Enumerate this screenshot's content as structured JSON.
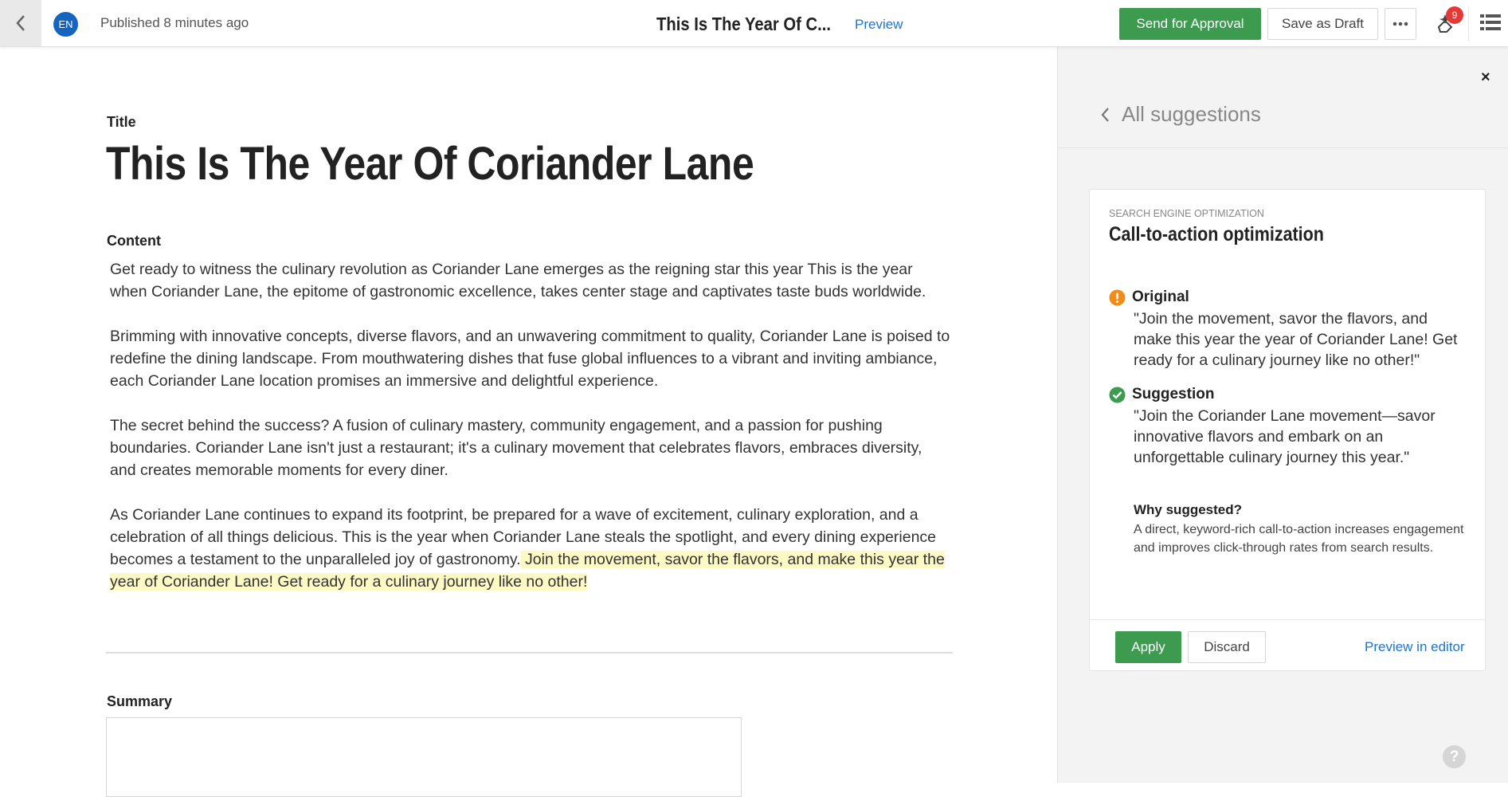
{
  "header": {
    "language": "EN",
    "status": "Published 8 minutes ago",
    "doc_title": "This Is The Year Of C...",
    "preview_label": "Preview",
    "send_label": "Send for Approval",
    "draft_label": "Save as Draft",
    "notification_count": "9"
  },
  "editor": {
    "title_label": "Title",
    "title": "This Is The Year Of Coriander Lane",
    "content_label": "Content",
    "paragraphs": [
      "Get ready to witness the culinary revolution as Coriander Lane emerges as the reigning star this year This is the year when Coriander Lane, the epitome of gastronomic excellence, takes center stage and captivates taste buds worldwide.",
      "Brimming with innovative concepts, diverse flavors, and an unwavering commitment to quality, Coriander Lane is poised to redefine the dining landscape. From mouthwatering dishes that fuse global influences to a vibrant and inviting ambiance, each Coriander Lane location promises an immersive and delightful experience.",
      "The secret behind the success? A fusion of culinary mastery, community engagement, and a passion for pushing boundaries. Coriander Lane isn't just a restaurant; it's a culinary movement that celebrates flavors, embraces diversity, and creates memorable moments for every diner.",
      "As Coriander Lane continues to expand its footprint, be prepared for a wave of excitement, culinary exploration, and a celebration of all things delicious. This is the year when Coriander Lane steals the spotlight, and every dining experience becomes a testament to the unparalleled joy of gastronomy."
    ],
    "highlighted": " Join the movement, savor the flavors, and make this year the year of Coriander Lane! Get ready for a culinary journey like no other! ",
    "summary_label": "Summary"
  },
  "panel": {
    "back_label": "All suggestions",
    "close": "×",
    "card": {
      "category": "SEARCH ENGINE OPTIMIZATION",
      "title": "Call-to-action optimization",
      "original_label": "Original",
      "original_text": "\"Join the movement, savor the flavors, and make this year the year of Coriander Lane! Get ready for a culinary journey like no other!\"",
      "suggestion_label": "Suggestion",
      "suggestion_text": "\"Join the Coriander Lane movement—savor innovative flavors and embark on an unforgettable culinary journey this year.\"",
      "why_label": "Why suggested?",
      "why_text": "A direct, keyword-rich call-to-action increases engagement and improves click-through rates from search results.",
      "apply_label": "Apply",
      "discard_label": "Discard",
      "preview_label": "Preview in editor"
    }
  },
  "colors": {
    "primary_green": "#3c9b4f",
    "link_blue": "#1976d2",
    "highlight": "#fdf9c4",
    "warning_orange": "#f08c1a",
    "success_green": "#3c9b4f"
  },
  "icons": [
    "chevron-left-icon",
    "more-dots-icon",
    "suggestions-icon",
    "list-icon",
    "warning-icon",
    "check-circle-icon",
    "help-icon"
  ]
}
